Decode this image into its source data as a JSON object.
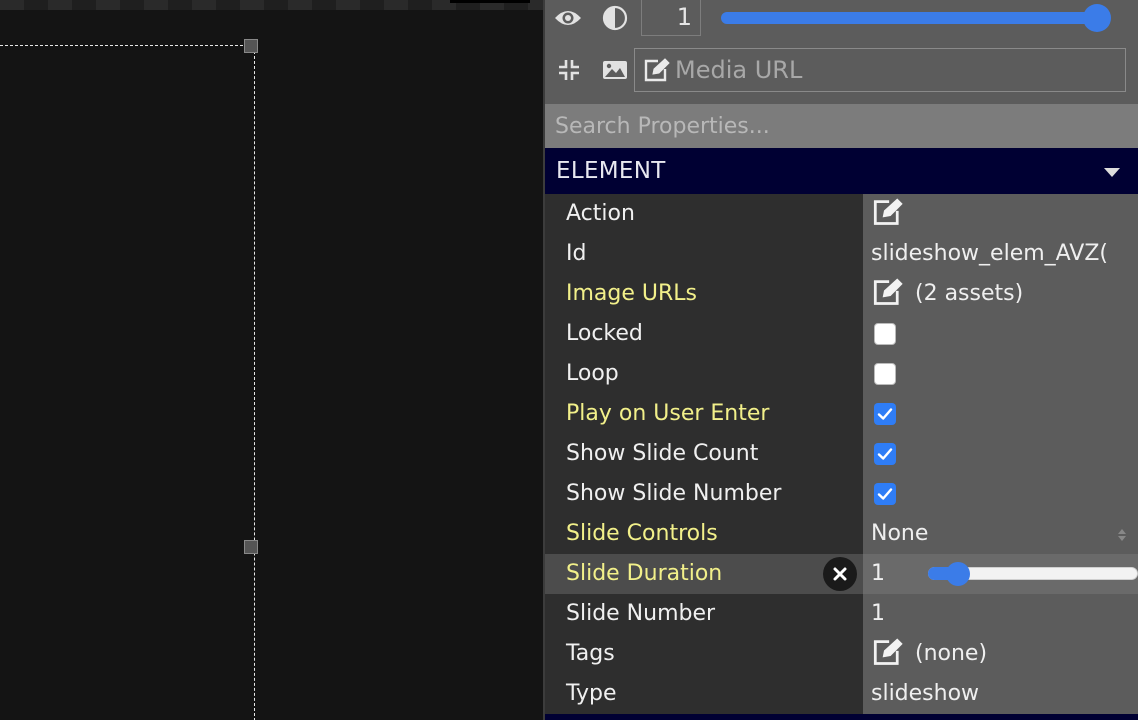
{
  "toolbar": {
    "counter_value": "1",
    "opacity_slider_percent": 100,
    "media_url_placeholder": "Media URL"
  },
  "search": {
    "placeholder": "Search Properties..."
  },
  "section": {
    "title": "ELEMENT"
  },
  "properties": [
    {
      "label": "Action",
      "highlight": false,
      "kind": "edit",
      "value": ""
    },
    {
      "label": "Id",
      "highlight": false,
      "kind": "text",
      "value": "slideshow_elem_AVZ("
    },
    {
      "label": "Image URLs",
      "highlight": true,
      "kind": "edit",
      "value": "(2 assets)"
    },
    {
      "label": "Locked",
      "highlight": false,
      "kind": "checkbox",
      "checked": false
    },
    {
      "label": "Loop",
      "highlight": false,
      "kind": "checkbox",
      "checked": false
    },
    {
      "label": "Play on User Enter",
      "highlight": true,
      "kind": "checkbox",
      "checked": true
    },
    {
      "label": "Show Slide Count",
      "highlight": false,
      "kind": "checkbox",
      "checked": true
    },
    {
      "label": "Show Slide Number",
      "highlight": false,
      "kind": "checkbox",
      "checked": true
    },
    {
      "label": "Slide Controls",
      "highlight": true,
      "kind": "select",
      "value": "None"
    },
    {
      "label": "Slide Duration",
      "highlight": true,
      "kind": "slider",
      "value": "1",
      "slider_percent": 5
    },
    {
      "label": "Slide Number",
      "highlight": false,
      "kind": "text",
      "value": "1"
    },
    {
      "label": "Tags",
      "highlight": false,
      "kind": "edit",
      "value": "(none)"
    },
    {
      "label": "Type",
      "highlight": false,
      "kind": "text",
      "value": "slideshow"
    }
  ],
  "colors": {
    "accent": "#3b7ce8",
    "label_highlight": "#f2f08a",
    "section_header_bg": "#000033",
    "checkbox_checked": "#2f7df6"
  },
  "icons": [
    "eye-icon",
    "opacity-icon",
    "collapse-icon",
    "image-icon",
    "edit-icon",
    "clear-icon",
    "check-icon",
    "select-arrows-icon"
  ]
}
